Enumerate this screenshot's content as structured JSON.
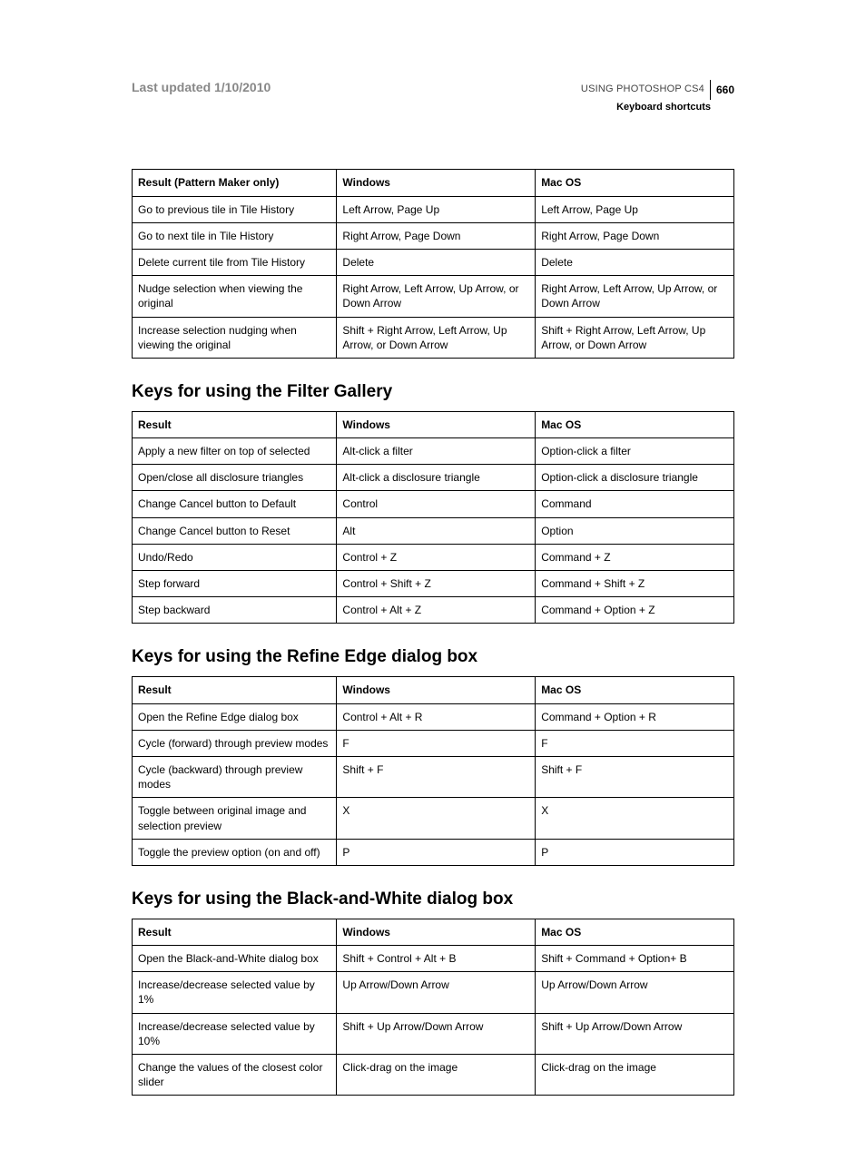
{
  "header": {
    "last_updated": "Last updated 1/10/2010",
    "doc_title": "USING PHOTOSHOP CS4",
    "page_number": "660",
    "section_name": "Keyboard shortcuts"
  },
  "tables": [
    {
      "heading": null,
      "columns": [
        "Result (Pattern Maker only)",
        "Windows",
        "Mac OS"
      ],
      "rows": [
        [
          "Go to previous tile in Tile History",
          "Left Arrow, Page Up",
          "Left Arrow, Page Up"
        ],
        [
          "Go to next tile in Tile History",
          "Right Arrow, Page Down",
          "Right Arrow, Page Down"
        ],
        [
          "Delete current tile from Tile History",
          "Delete",
          "Delete"
        ],
        [
          "Nudge selection when viewing the original",
          "Right Arrow, Left Arrow, Up Arrow, or Down Arrow",
          "Right Arrow, Left Arrow, Up Arrow, or Down Arrow"
        ],
        [
          "Increase selection nudging when viewing the original",
          "Shift + Right Arrow, Left Arrow, Up Arrow, or Down Arrow",
          "Shift + Right Arrow, Left Arrow, Up Arrow, or Down Arrow"
        ]
      ]
    },
    {
      "heading": "Keys for using the Filter Gallery",
      "columns": [
        "Result",
        "Windows",
        "Mac OS"
      ],
      "rows": [
        [
          "Apply a new filter on top of selected",
          "Alt-click a filter",
          "Option-click a filter"
        ],
        [
          "Open/close all disclosure triangles",
          "Alt-click a disclosure triangle",
          "Option-click a disclosure triangle"
        ],
        [
          "Change Cancel button to Default",
          "Control",
          "Command"
        ],
        [
          "Change Cancel button to Reset",
          "Alt",
          "Option"
        ],
        [
          "Undo/Redo",
          "Control + Z",
          "Command + Z"
        ],
        [
          "Step forward",
          "Control + Shift + Z",
          "Command + Shift + Z"
        ],
        [
          "Step backward",
          "Control + Alt + Z",
          "Command + Option + Z"
        ]
      ]
    },
    {
      "heading": "Keys for using the Refine Edge dialog box",
      "columns": [
        "Result",
        "Windows",
        "Mac OS"
      ],
      "rows": [
        [
          "Open the Refine Edge dialog box",
          "Control + Alt + R",
          "Command + Option + R"
        ],
        [
          "Cycle (forward) through preview modes",
          "F",
          "F"
        ],
        [
          "Cycle (backward) through preview modes",
          "Shift + F",
          "Shift + F"
        ],
        [
          "Toggle between original image and selection preview",
          "X",
          "X"
        ],
        [
          "Toggle the preview option (on and off)",
          "P",
          "P"
        ]
      ]
    },
    {
      "heading": "Keys for using the Black-and-White dialog box",
      "columns": [
        "Result",
        "Windows",
        "Mac OS"
      ],
      "rows": [
        [
          "Open the Black-and-White dialog box",
          "Shift + Control + Alt + B",
          "Shift + Command + Option+ B"
        ],
        [
          "Increase/decrease selected value by 1%",
          "Up Arrow/Down Arrow",
          "Up Arrow/Down Arrow"
        ],
        [
          "Increase/decrease selected value by 10%",
          "Shift + Up Arrow/Down Arrow",
          "Shift + Up Arrow/Down Arrow"
        ],
        [
          "Change the values of the closest color slider",
          "Click-drag on the image",
          "Click-drag on the image"
        ]
      ]
    }
  ]
}
